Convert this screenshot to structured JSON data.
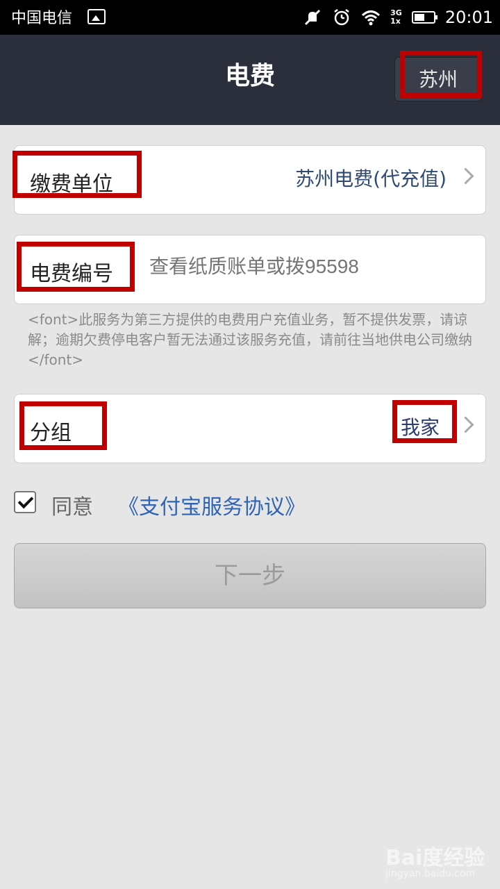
{
  "status_bar": {
    "carrier": "中国电信",
    "network_top": "3G",
    "network_bottom": "1x",
    "time": "20:01"
  },
  "header": {
    "title": "电费",
    "city": "苏州"
  },
  "payment_unit": {
    "label": "缴费单位",
    "value": "苏州电费(代充值)"
  },
  "account": {
    "label": "电费编号",
    "placeholder": "查看纸质账单或拨95598"
  },
  "notice": "<font>此服务为第三方提供的电费用户充值业务，暂不提供发票，请谅解；逾期欠费停电客户暂无法通过该服务充值，请前往当地供电公司缴纳</font>",
  "group": {
    "label": "分组",
    "value": "我家"
  },
  "agreement": {
    "prefix": "同意",
    "link": "《支付宝服务协议》",
    "checked": true
  },
  "next_button": "下一步",
  "watermark": {
    "main": "Bai度经验",
    "sub": "jingyan.baidu.com"
  },
  "colors": {
    "header_bg": "#2b2f3b",
    "highlight": "#c00000",
    "link": "#2f64b5",
    "value_text": "#2f4b73"
  }
}
